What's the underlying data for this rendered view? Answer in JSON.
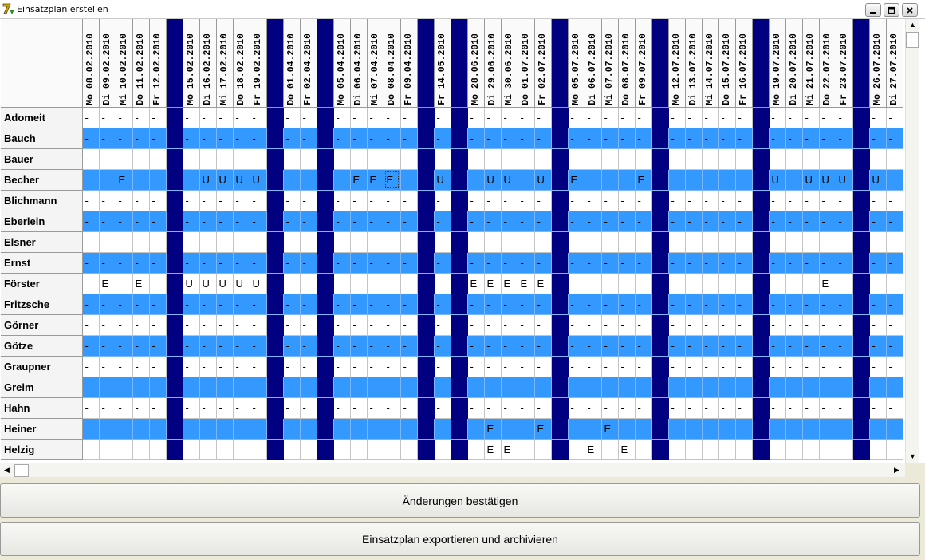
{
  "window": {
    "title": "Einsatzplan erstellen"
  },
  "grid": {
    "columns": [
      "Mo 08.02.2010",
      "Di 09.02.2010",
      "Mi 10.02.2010",
      "Do 11.02.2010",
      "Fr 12.02.2010",
      "",
      "Mo 15.02.2010",
      "Di 16.02.2010",
      "Mi 17.02.2010",
      "Do 18.02.2010",
      "Fr 19.02.2010",
      "",
      "Do 01.04.2010",
      "Fr 02.04.2010",
      "",
      "Mo 05.04.2010",
      "Di 06.04.2010",
      "Mi 07.04.2010",
      "Do 08.04.2010",
      "Fr 09.04.2010",
      "",
      "Fr 14.05.2010",
      "",
      "Mo 28.06.2010",
      "Di 29.06.2010",
      "Mi 30.06.2010",
      "Do 01.07.2010",
      "Fr 02.07.2010",
      "",
      "Mo 05.07.2010",
      "Di 06.07.2010",
      "Mi 07.07.2010",
      "Do 08.07.2010",
      "Fr 09.07.2010",
      "",
      "Mo 12.07.2010",
      "Di 13.07.2010",
      "Mi 14.07.2010",
      "Do 15.07.2010",
      "Fr 16.07.2010",
      "",
      "Mo 19.07.2010",
      "Di 20.07.2010",
      "Mi 21.07.2010",
      "Do 22.07.2010",
      "Fr 23.07.2010",
      "",
      "Mo 26.07.2010",
      "Di 27.07.2010"
    ],
    "rows": [
      {
        "name": "Adomeit",
        "cells": [
          "-",
          "-",
          "-",
          "-",
          "-",
          "",
          "-",
          "-",
          "-",
          "-",
          "-",
          "",
          "-",
          "-",
          "",
          "-",
          "-",
          "-",
          "-",
          "-",
          "",
          "-",
          "",
          "-",
          "-",
          "-",
          "-",
          "-",
          "",
          "-",
          "-",
          "-",
          "-",
          "-",
          "",
          "-",
          "-",
          "-",
          "-",
          "-",
          "",
          "-",
          "-",
          "-",
          "-",
          "-",
          "",
          "-",
          "-"
        ]
      },
      {
        "name": "Bauch",
        "cells": [
          "-",
          "-",
          "-",
          "-",
          "-",
          "",
          "-",
          "-",
          "-",
          "-",
          "-",
          "",
          "-",
          "-",
          "",
          "-",
          "-",
          "-",
          "-",
          "-",
          "",
          "-",
          "",
          "-",
          "-",
          "-",
          "-",
          "-",
          "",
          "-",
          "-",
          "-",
          "-",
          "-",
          "",
          "-",
          "-",
          "-",
          "-",
          "-",
          "",
          "-",
          "-",
          "-",
          "-",
          "-",
          "",
          "-",
          "-"
        ]
      },
      {
        "name": "Bauer",
        "cells": [
          "-",
          "-",
          "-",
          "-",
          "-",
          "",
          "-",
          "-",
          "-",
          "-",
          "-",
          "",
          "-",
          "-",
          "",
          "-",
          "-",
          "-",
          "-",
          "-",
          "",
          "-",
          "",
          "-",
          "-",
          "-",
          "-",
          "-",
          "",
          "-",
          "-",
          "-",
          "-",
          "-",
          "",
          "-",
          "-",
          "-",
          "-",
          "-",
          "",
          "-",
          "-",
          "-",
          "-",
          "-",
          "",
          "-",
          "-"
        ]
      },
      {
        "name": "Becher",
        "cells": [
          "",
          "",
          "E",
          "",
          "",
          "",
          "",
          "U",
          "U",
          "U",
          "U",
          "",
          "",
          "",
          "",
          "",
          "E",
          "E",
          "E",
          "",
          "",
          "U",
          "",
          "",
          "U",
          "U",
          "",
          "U",
          "",
          "E",
          "",
          "",
          "",
          "E",
          "",
          "",
          "",
          "",
          "",
          "",
          "",
          "U",
          "",
          "U",
          "U",
          "U",
          "",
          "U",
          ""
        ]
      },
      {
        "name": "Blichmann",
        "cells": [
          "-",
          "-",
          "-",
          "-",
          "-",
          "",
          "-",
          "-",
          "-",
          "-",
          "-",
          "",
          "-",
          "-",
          "",
          "-",
          "-",
          "-",
          "-",
          "-",
          "",
          "-",
          "",
          "-",
          "-",
          "-",
          "-",
          "-",
          "",
          "-",
          "-",
          "-",
          "-",
          "-",
          "",
          "-",
          "-",
          "-",
          "-",
          "-",
          "",
          "-",
          "-",
          "-",
          "-",
          "-",
          "",
          "-",
          "-"
        ]
      },
      {
        "name": "Eberlein",
        "cells": [
          "-",
          "-",
          "-",
          "-",
          "-",
          "",
          "-",
          "-",
          "-",
          "-",
          "-",
          "",
          "-",
          "-",
          "",
          "-",
          "-",
          "-",
          "-",
          "-",
          "",
          "-",
          "",
          "-",
          "-",
          "-",
          "-",
          "-",
          "",
          "-",
          "-",
          "-",
          "-",
          "-",
          "",
          "-",
          "-",
          "-",
          "-",
          "-",
          "",
          "-",
          "-",
          "-",
          "-",
          "-",
          "",
          "-",
          "-"
        ]
      },
      {
        "name": "Elsner",
        "cells": [
          "-",
          "-",
          "-",
          "-",
          "-",
          "",
          "-",
          "-",
          "-",
          "-",
          "-",
          "",
          "-",
          "-",
          "",
          "-",
          "-",
          "-",
          "-",
          "-",
          "",
          "-",
          "",
          "-",
          "-",
          "-",
          "-",
          "-",
          "",
          "-",
          "-",
          "-",
          "-",
          "-",
          "",
          "-",
          "-",
          "-",
          "-",
          "-",
          "",
          "-",
          "-",
          "-",
          "-",
          "-",
          "",
          "-",
          "-"
        ]
      },
      {
        "name": "Ernst",
        "cells": [
          "-",
          "-",
          "-",
          "-",
          "-",
          "",
          "-",
          "-",
          "-",
          "-",
          "-",
          "",
          "-",
          "-",
          "",
          "-",
          "-",
          "-",
          "-",
          "-",
          "",
          "-",
          "",
          "-",
          "-",
          "-",
          "-",
          "-",
          "",
          "-",
          "-",
          "-",
          "-",
          "-",
          "",
          "-",
          "-",
          "-",
          "-",
          "-",
          "",
          "-",
          "-",
          "-",
          "-",
          "-",
          "",
          "-",
          "-"
        ]
      },
      {
        "name": "Förster",
        "cells": [
          "",
          "E",
          "",
          "E",
          "",
          "",
          "U",
          "U",
          "U",
          "U",
          "U",
          "",
          "",
          "",
          "",
          "",
          "",
          "",
          "",
          "",
          "",
          "",
          "",
          "E",
          "E",
          "E",
          "E",
          "E",
          "",
          "",
          "",
          "",
          "",
          "",
          "",
          "",
          "",
          "",
          "",
          "",
          "",
          "",
          "",
          "",
          "E",
          "",
          "",
          "",
          ""
        ]
      },
      {
        "name": "Fritzsche",
        "cells": [
          "-",
          "-",
          "-",
          "-",
          "-",
          "",
          "-",
          "-",
          "-",
          "-",
          "-",
          "",
          "-",
          "-",
          "",
          "-",
          "-",
          "-",
          "-",
          "-",
          "",
          "-",
          "",
          "-",
          "-",
          "-",
          "-",
          "-",
          "",
          "-",
          "-",
          "-",
          "-",
          "-",
          "",
          "-",
          "-",
          "-",
          "-",
          "-",
          "",
          "-",
          "-",
          "-",
          "-",
          "-",
          "",
          "-",
          "-"
        ]
      },
      {
        "name": "Görner",
        "cells": [
          "-",
          "-",
          "-",
          "-",
          "-",
          "",
          "-",
          "-",
          "-",
          "-",
          "-",
          "",
          "-",
          "-",
          "",
          "-",
          "-",
          "-",
          "-",
          "-",
          "",
          "-",
          "",
          "-",
          "-",
          "-",
          "-",
          "-",
          "",
          "-",
          "-",
          "-",
          "-",
          "-",
          "",
          "-",
          "-",
          "-",
          "-",
          "-",
          "",
          "-",
          "-",
          "-",
          "-",
          "-",
          "",
          "-",
          "-"
        ]
      },
      {
        "name": "Götze",
        "cells": [
          "-",
          "-",
          "-",
          "-",
          "-",
          "",
          "-",
          "-",
          "-",
          "-",
          "-",
          "",
          "-",
          "-",
          "",
          "-",
          "-",
          "-",
          "-",
          "-",
          "",
          "-",
          "",
          "-",
          "-",
          "-",
          "-",
          "-",
          "",
          "-",
          "-",
          "-",
          "-",
          "-",
          "",
          "-",
          "-",
          "-",
          "-",
          "-",
          "",
          "-",
          "-",
          "-",
          "-",
          "-",
          "",
          "-",
          "-"
        ]
      },
      {
        "name": "Graupner",
        "cells": [
          "-",
          "-",
          "-",
          "-",
          "-",
          "",
          "-",
          "-",
          "-",
          "-",
          "-",
          "",
          "-",
          "-",
          "",
          "-",
          "-",
          "-",
          "-",
          "-",
          "",
          "-",
          "",
          "-",
          "-",
          "-",
          "-",
          "-",
          "",
          "-",
          "-",
          "-",
          "-",
          "-",
          "",
          "-",
          "-",
          "-",
          "-",
          "-",
          "",
          "-",
          "-",
          "-",
          "-",
          "-",
          "",
          "-",
          "-"
        ]
      },
      {
        "name": "Greim",
        "cells": [
          "-",
          "-",
          "-",
          "-",
          "-",
          "",
          "-",
          "-",
          "-",
          "-",
          "-",
          "",
          "-",
          "-",
          "",
          "-",
          "-",
          "-",
          "-",
          "-",
          "",
          "-",
          "",
          "-",
          "-",
          "-",
          "-",
          "-",
          "",
          "-",
          "-",
          "-",
          "-",
          "-",
          "",
          "-",
          "-",
          "-",
          "-",
          "-",
          "",
          "-",
          "-",
          "-",
          "-",
          "-",
          "",
          "-",
          "-"
        ]
      },
      {
        "name": "Hahn",
        "cells": [
          "-",
          "-",
          "-",
          "-",
          "-",
          "",
          "-",
          "-",
          "-",
          "-",
          "-",
          "",
          "-",
          "-",
          "",
          "-",
          "-",
          "-",
          "-",
          "-",
          "",
          "-",
          "",
          "-",
          "-",
          "-",
          "-",
          "-",
          "",
          "-",
          "-",
          "-",
          "-",
          "-",
          "",
          "-",
          "-",
          "-",
          "-",
          "-",
          "",
          "-",
          "-",
          "-",
          "-",
          "-",
          "",
          "-",
          "-"
        ]
      },
      {
        "name": "Heiner",
        "cells": [
          "",
          "",
          "",
          "",
          "",
          "",
          "",
          "",
          "",
          "",
          "",
          "",
          "",
          "",
          "",
          "",
          "",
          "",
          "",
          "",
          "",
          "",
          "",
          "",
          "E",
          "",
          "",
          "E",
          "",
          "",
          "",
          "E",
          "",
          "",
          "",
          "",
          "",
          "",
          "",
          "",
          "",
          "",
          "",
          "",
          "",
          "",
          "",
          "",
          ""
        ]
      },
      {
        "name": "Helzig",
        "cells": [
          "",
          "",
          "",
          "",
          "",
          "",
          "",
          "",
          "",
          "",
          "",
          "",
          "",
          "",
          "",
          "",
          "",
          "",
          "",
          "",
          "",
          "",
          "",
          "",
          "E",
          "E",
          "",
          "",
          "",
          "",
          "E",
          "",
          "E",
          "",
          "",
          "",
          "",
          "",
          "",
          "",
          "",
          "",
          "",
          "",
          "",
          "",
          "",
          "",
          ""
        ]
      }
    ]
  },
  "buttons": {
    "confirm": "Änderungen bestätigen",
    "export": "Einsatzplan exportieren und archivieren"
  },
  "colors": {
    "separator": "#000080",
    "row_alt": "#3399ff"
  }
}
